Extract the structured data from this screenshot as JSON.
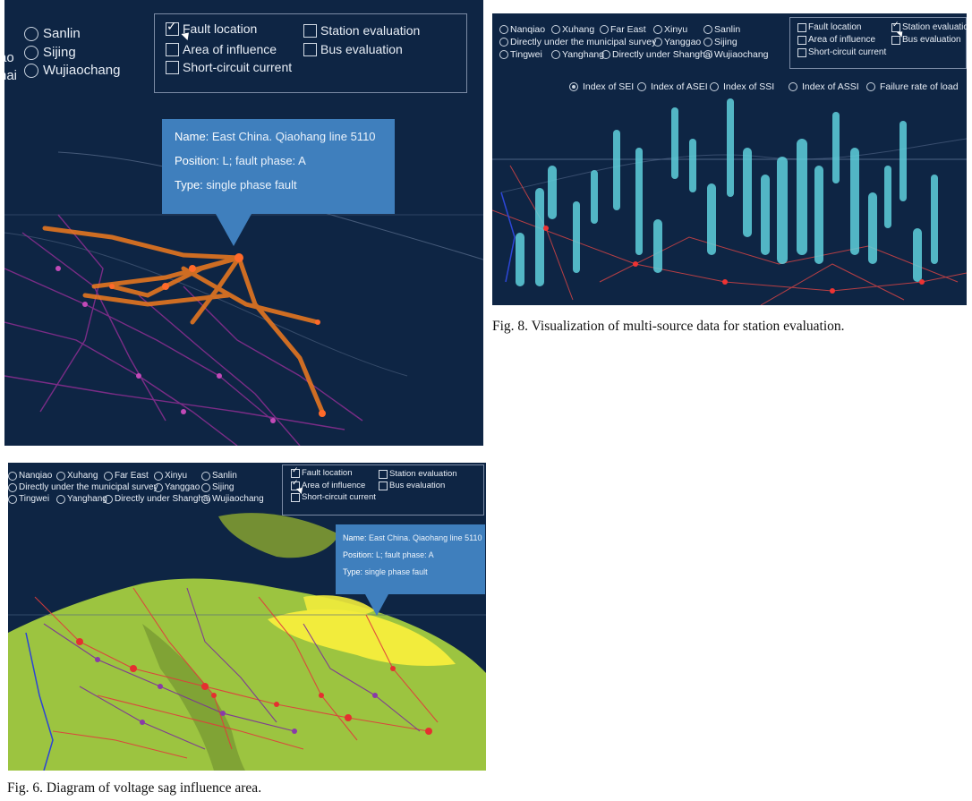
{
  "panel_a": {
    "radios": [
      "Sanlin",
      "Sijing",
      "Wujiaochang"
    ],
    "radio_partial": [
      "ao",
      "hai"
    ],
    "checks": {
      "fault_location": "Fault location",
      "area_of_influence": "Area of influence",
      "short_circuit_current": "Short-circuit current",
      "station_evaluation": "Station evaluation",
      "bus_evaluation": "Bus evaluation"
    },
    "tooltip": {
      "name_key": "Name:",
      "name_val": "East China. Qiaohang line 5110",
      "position_key": "Position:",
      "position_val": "L; fault phase: A",
      "type_key": "Type:",
      "type_val": "single phase fault"
    }
  },
  "panel_b": {
    "radios": {
      "nanqiao": "Nanqiao",
      "xuhang": "Xuhang",
      "far_east": "Far East",
      "xinyu": "Xinyu",
      "sanlin": "Sanlin",
      "directly_survey": "Directly under the municipal survey",
      "yanggao": "Yanggao",
      "sijing": "Sijing",
      "tingwei": "Tingwei",
      "yanghang": "Yanghang",
      "directly_shanghai": "Directly under Shanghai",
      "wujiaochang": "Wujiaochang"
    },
    "checks": {
      "fault_location": "Fault location",
      "area_of_influence": "Area of influence",
      "short_circuit_current": "Short-circuit current",
      "station_evaluation": "Station evaluation",
      "bus_evaluation": "Bus evaluation"
    },
    "indices": {
      "sei": "Index of SEI",
      "asei": "Index of ASEI",
      "ssi": "Index of SSI",
      "assi": "Index of ASSI",
      "failure": "Failure rate of load"
    }
  },
  "panel_c": {
    "radios": {
      "nanqiao": "Nanqiao",
      "xuhang": "Xuhang",
      "far_east": "Far East",
      "xinyu": "Xinyu",
      "sanlin": "Sanlin",
      "directly_survey": "Directly under the municipal survey",
      "yanggao": "Yanggao",
      "sijing": "Sijing",
      "tingwei": "Tingwei",
      "yanghang": "Yanghang",
      "directly_shanghai": "Directly under Shanghai",
      "wujiaochang": "Wujiaochang"
    },
    "checks": {
      "fault_location": "Fault location",
      "area_of_influence": "Area of influence",
      "short_circuit_current": "Short-circuit current",
      "station_evaluation": "Station evaluation",
      "bus_evaluation": "Bus evaluation"
    },
    "tooltip": {
      "name_key": "Name:",
      "name_val": "East China. Qiaohang line 5110",
      "position_key": "Position:",
      "position_val": "L; fault phase: A",
      "type_key": "Type:",
      "type_val": "single phase fault"
    }
  },
  "captions": {
    "fig8": "Fig. 8.   Visualization of multi-source data for station evaluation.",
    "fig6": "Fig. 6.   Diagram of voltage sag influence area."
  },
  "colors": {
    "background": "#0e2544",
    "orange_lines": "#f07a1e",
    "cylinders": "#5fd0dc",
    "land_green": "#9cc440",
    "sag_yellow": "#f2ec3c",
    "tooltip": "#3f7fbd"
  }
}
